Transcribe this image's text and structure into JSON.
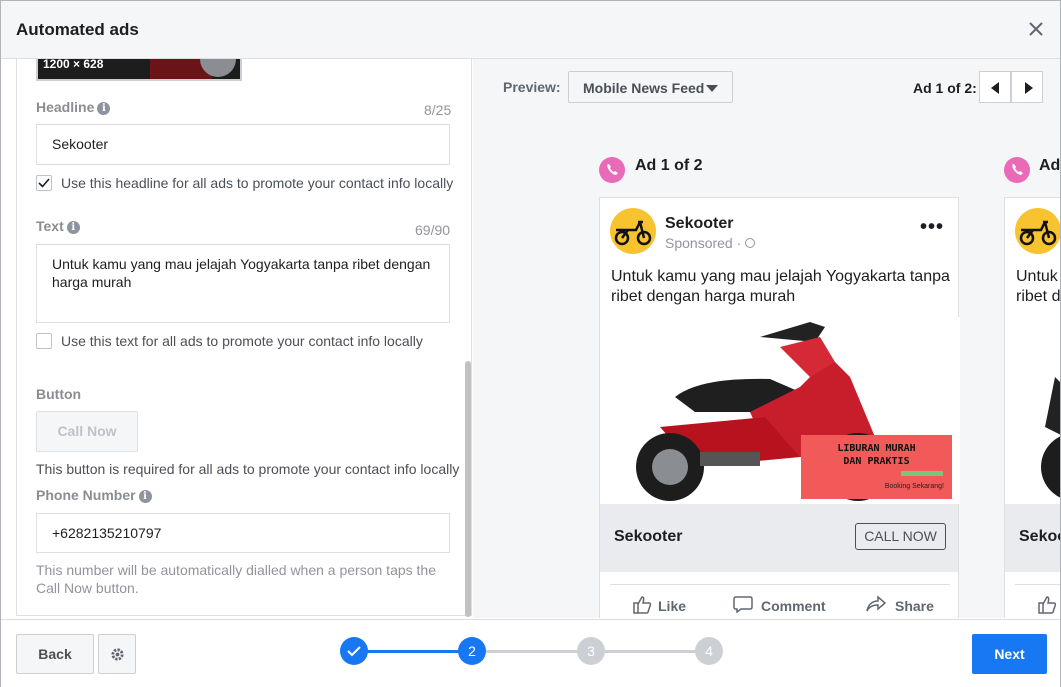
{
  "header": {
    "title": "Automated ads",
    "close_icon": "close-icon"
  },
  "left": {
    "image_size": "1200 × 628",
    "headline": {
      "label": "Headline",
      "counter": "8/25",
      "value": "Sekooter",
      "checkbox_label": "Use this headline for all ads to promote your contact info locally",
      "checked": true
    },
    "text": {
      "label": "Text",
      "counter": "69/90",
      "value": "Untuk kamu yang mau jelajah Yogyakarta tanpa ribet dengan harga murah",
      "checkbox_label": "Use this text for all ads to promote your contact info locally",
      "checked": false
    },
    "button": {
      "label": "Button",
      "value": "Call Now",
      "help": "This button is required for all ads to promote your contact info locally"
    },
    "phone": {
      "label": "Phone Number",
      "value": "+6282135210797",
      "help": "This number will be automatically dialled when a person taps the Call Now button."
    }
  },
  "preview": {
    "label": "Preview:",
    "placement": "Mobile News Feed",
    "ad_counter": "Ad 1 of 2:",
    "ad_title": "Ad 1 of 2",
    "ad_title_partial": "Ad",
    "page_name": "Sekooter",
    "sponsored": "Sponsored ·",
    "primary_text": "Untuk kamu yang mau jelajah Yogyakarta tanpa ribet dengan harga murah",
    "partial_text_1": "Untuk",
    "partial_text_2": "ribet d",
    "banner_line1": "LIBURAN MURAH",
    "banner_line2": "DAN PRAKTIS",
    "banner_small": "Booking Sekarang!",
    "headline": "Sekooter",
    "headline_partial": "Sekoo",
    "cta": "CALL NOW",
    "actions": {
      "like": "Like",
      "comment": "Comment",
      "share": "Share"
    }
  },
  "footer": {
    "back": "Back",
    "next": "Next",
    "steps": [
      "1",
      "2",
      "3",
      "4"
    ],
    "current_step": 2,
    "accent": "#1877f2"
  }
}
